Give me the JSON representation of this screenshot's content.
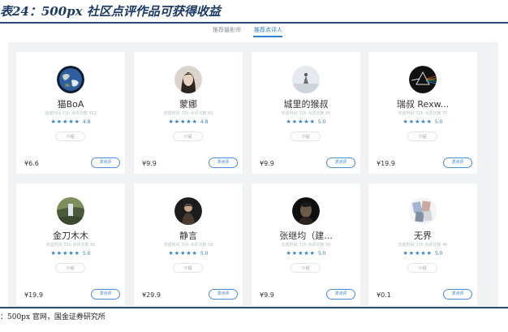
{
  "figure": {
    "title": "表24：500px 社区点评作品可获得收益",
    "source": "：500px 官网，国金证券研究所"
  },
  "tabs": [
    {
      "label": "推荐摄影师",
      "active": false
    },
    {
      "label": "推荐点评人",
      "active": true
    }
  ],
  "colors": {
    "accent": "#2f7fd6",
    "title": "#1b3a66",
    "panel_bg": "#f1f2f4"
  },
  "cards": [
    {
      "name": "猫BoA",
      "stats": "完成时间 72h  点评次数 351",
      "stars": "★★★★★",
      "rating": "4.8",
      "intro": "介绍",
      "price": "¥6.6",
      "button": "求点评",
      "avatar": "earth-avatar"
    },
    {
      "name": "蒙娜",
      "stats": "完成时间 72h  点评次数 89",
      "stars": "★★★★★",
      "rating": "4.8",
      "intro": "介绍",
      "price": "¥9.9",
      "button": "求点评",
      "avatar": "portrait-avatar"
    },
    {
      "name": "城里的猴叔",
      "stats": "完成时间 72h  点评次数 85",
      "stars": "★★★★★",
      "rating": "5.0",
      "intro": "介绍",
      "price": "¥9.9",
      "button": "求点评",
      "avatar": "sky-avatar"
    },
    {
      "name": "瑞叔 Rexw...",
      "stats": "完成时间 72h  点评次数 70",
      "stars": "★★★★★",
      "rating": "5.0",
      "intro": "介绍",
      "price": "¥19.9",
      "button": "求点评",
      "avatar": "prism-avatar"
    },
    {
      "name": "金刀木木",
      "stats": "完成时间 72h  点评次数 80",
      "stars": "★★★★★",
      "rating": "5.0",
      "intro": "介绍",
      "price": "¥19.9",
      "button": "求点评",
      "avatar": "waterfall-avatar"
    },
    {
      "name": "静言",
      "stats": "完成时间 72h  点评次数 59",
      "stars": "★★★★★",
      "rating": "5.0",
      "intro": "介绍",
      "price": "¥29.9",
      "button": "求点评",
      "avatar": "person-avatar"
    },
    {
      "name": "张继均（建...",
      "stats": "完成时间 72h  点评次数 56",
      "stars": "★★★★★",
      "rating": "5.0",
      "intro": "介绍",
      "price": "¥9.9",
      "button": "求点评",
      "avatar": "dark-portrait-avatar"
    },
    {
      "name": "无界",
      "stats": "完成时间 72h  点评次数 46",
      "stars": "★★★★★",
      "rating": "5.0",
      "intro": "介绍",
      "price": "¥0.1",
      "button": "求点评",
      "avatar": "collage-avatar"
    }
  ]
}
